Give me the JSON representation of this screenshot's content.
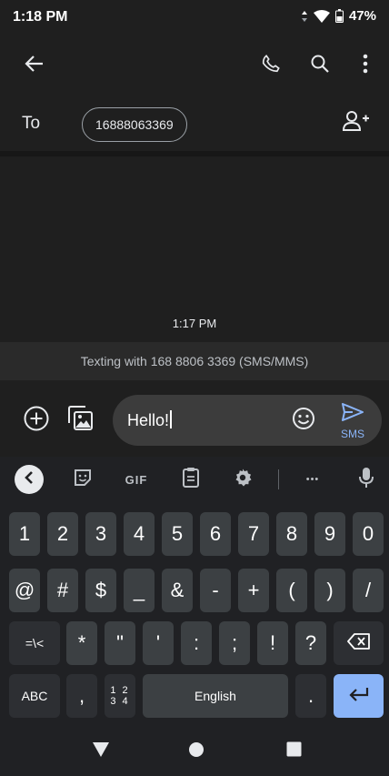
{
  "status_bar": {
    "time": "1:18 PM",
    "battery": "47%",
    "icons": [
      "data-arrows-icon",
      "wifi-icon",
      "battery-icon"
    ]
  },
  "app_bar": {
    "icons": [
      "back-arrow-icon",
      "phone-icon",
      "search-icon",
      "more-vert-icon"
    ]
  },
  "recipient": {
    "to_label": "To",
    "number_chip": "16888063369",
    "add_icon": "add-person-icon"
  },
  "conversation": {
    "timestamp": "1:17 PM",
    "banner": "Texting with 168 8806 3369 (SMS/MMS)"
  },
  "composer": {
    "message": "Hello!",
    "send_label": "SMS",
    "icons": [
      "add-circle-icon",
      "gallery-icon",
      "emoji-icon",
      "send-icon"
    ]
  },
  "keyboard": {
    "toolbar": {
      "gif_label": "GIF",
      "icons": [
        "back-chevron-icon",
        "sticker-icon",
        "gif-icon",
        "clipboard-icon",
        "settings-icon",
        "more-horiz-icon",
        "mic-icon"
      ],
      "more_label": "•••"
    },
    "row1": [
      "1",
      "2",
      "3",
      "4",
      "5",
      "6",
      "7",
      "8",
      "9",
      "0"
    ],
    "row2": [
      "@",
      "#",
      "$",
      "_",
      "&",
      "-",
      "+",
      "(",
      ")",
      "/"
    ],
    "row3": [
      "=\\<",
      "*",
      "\"",
      "'",
      ":",
      ";",
      "!",
      "?"
    ],
    "row4": {
      "abc": "ABC",
      "comma": ",",
      "numpad_top": "1 2",
      "numpad_bottom": "3 4",
      "space": "English",
      "period": "."
    }
  },
  "nav_bar": {
    "icons": [
      "back-triangle-icon",
      "home-circle-icon",
      "recents-square-icon"
    ]
  },
  "colors": {
    "background": "#1f1f1f",
    "keyboard": "#202124",
    "key": "#3c4043",
    "accent": "#8ab4f8"
  }
}
